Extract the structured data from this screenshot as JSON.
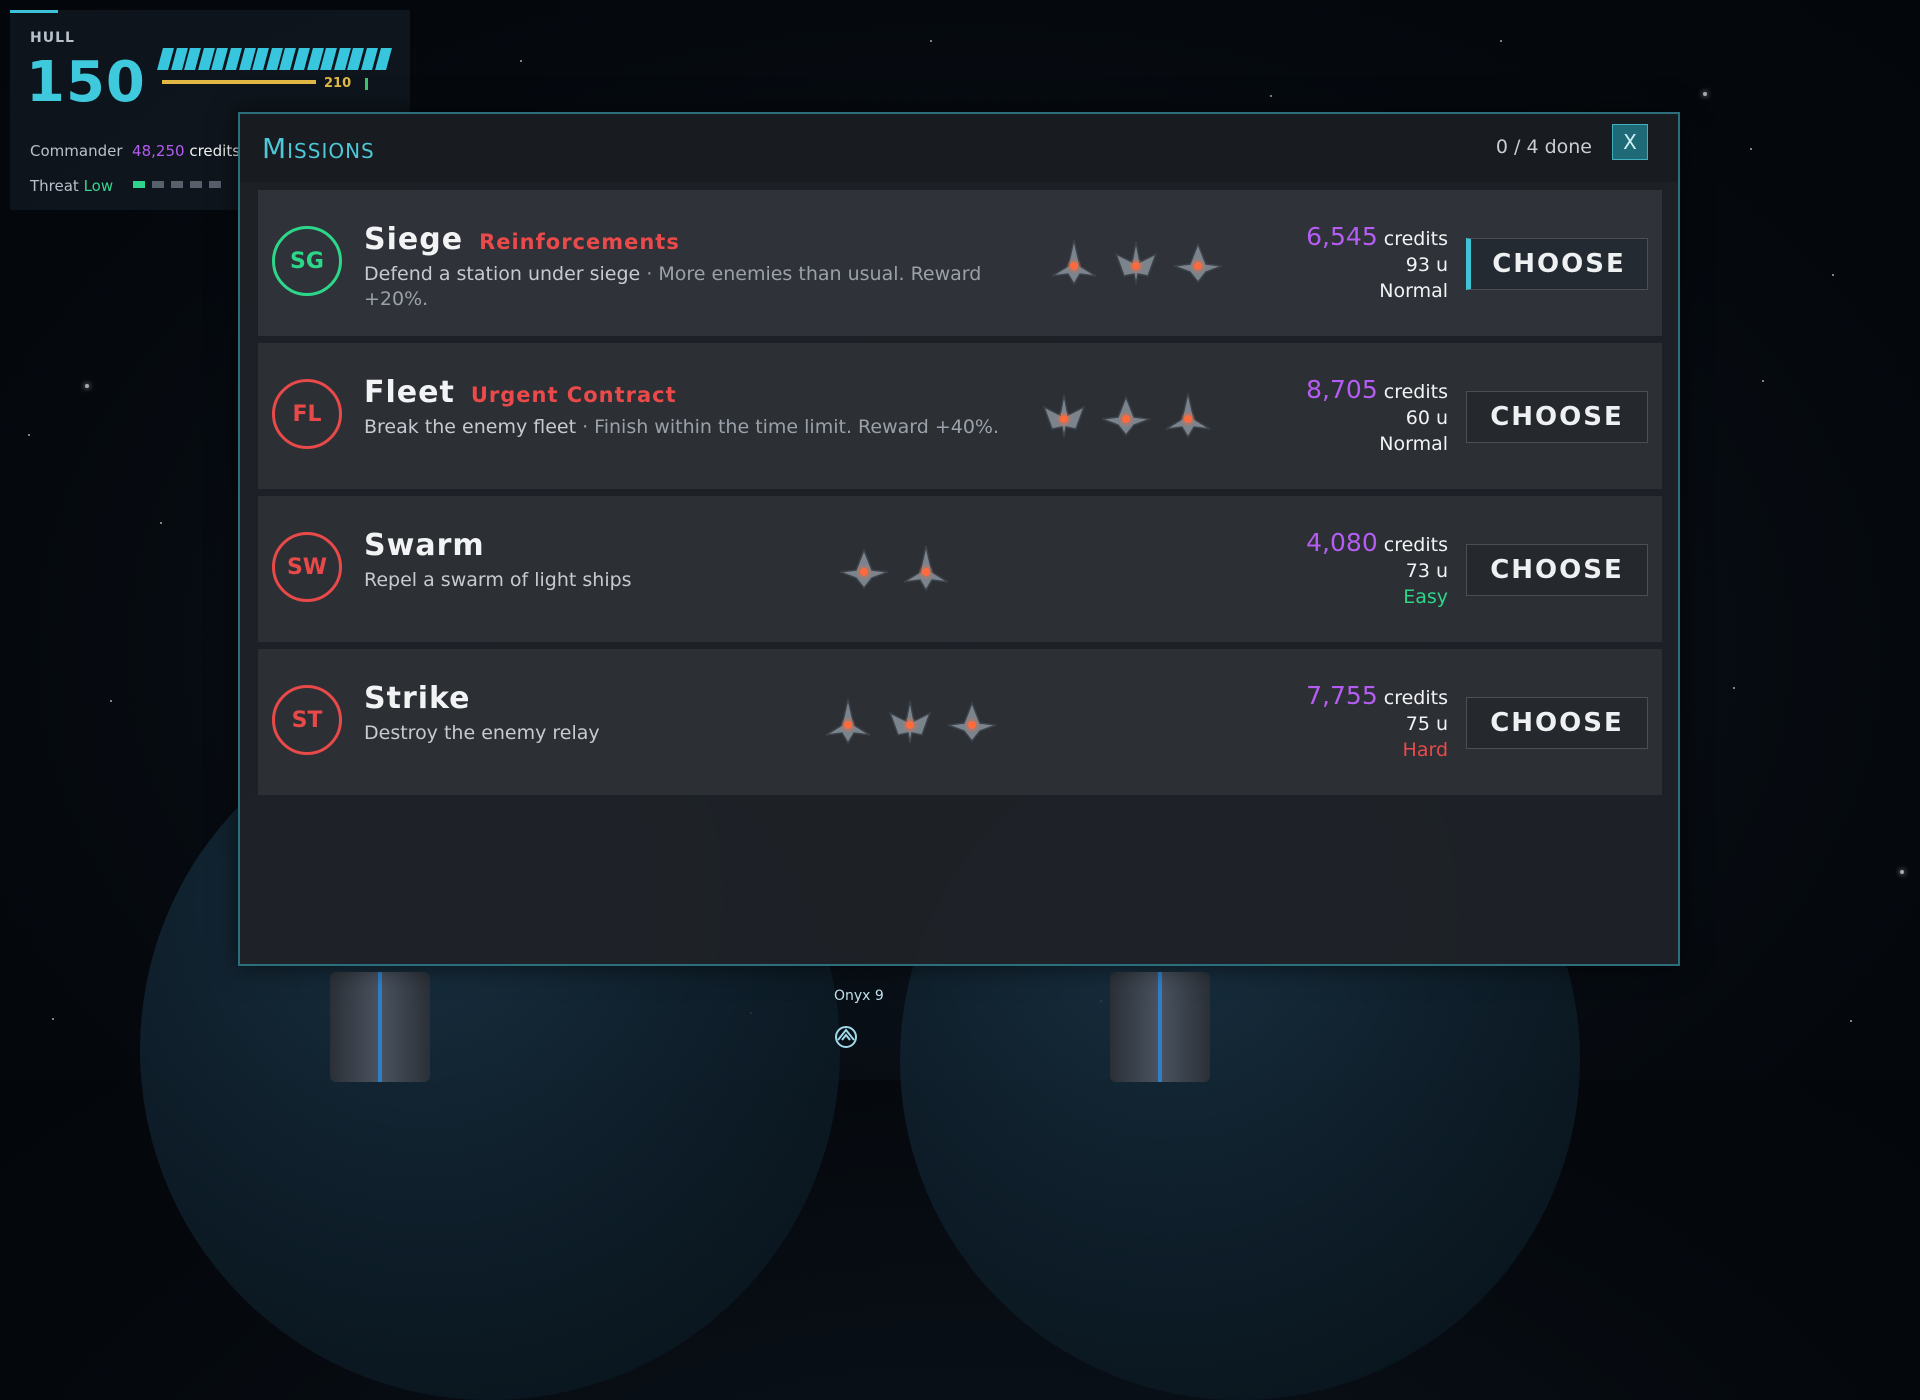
{
  "hud": {
    "hull_label": "HULL",
    "hull_value": "150",
    "hull_max": "210",
    "commander_label": "Commander",
    "credits_value": "48,250",
    "credits_label": "credits",
    "threat_label": "Threat",
    "threat_level": "Low",
    "threat_segments_filled": 1,
    "threat_segments_total": 5
  },
  "dialog": {
    "title": "Missions",
    "progress": "0 / 4 done",
    "close_label": "X"
  },
  "missions": [
    {
      "badge": "SG",
      "badge_color": "#2dd78a",
      "name": "Siege",
      "tag": "Reinforcements",
      "description": "Defend a station under siege",
      "extra": "· More enemies than usual. Reward +20%.",
      "credits": "6,545",
      "credits_label": "credits",
      "units": "93 u",
      "difficulty": "Normal",
      "button": "CHOOSE",
      "ships": 3
    },
    {
      "badge": "FL",
      "badge_color": "#e84949",
      "name": "Fleet",
      "tag": "Urgent Contract",
      "description": "Break the enemy fleet",
      "extra": "· Finish within the time limit. Reward +40%.",
      "credits": "8,705",
      "credits_label": "credits",
      "units": "60 u",
      "difficulty": "Normal",
      "button": "CHOOSE",
      "ships": 3
    },
    {
      "badge": "SW",
      "badge_color": "#e84949",
      "name": "Swarm",
      "tag": "",
      "description": "Repel a swarm of light ships",
      "extra": "",
      "credits": "4,080",
      "credits_label": "credits",
      "units": "73 u",
      "difficulty": "Easy",
      "button": "CHOOSE",
      "ships": 2
    },
    {
      "badge": "ST",
      "badge_color": "#e84949",
      "name": "Strike",
      "tag": "",
      "description": "Destroy the enemy relay",
      "extra": "",
      "credits": "7,755",
      "credits_label": "credits",
      "units": "75 u",
      "difficulty": "Hard",
      "button": "CHOOSE",
      "ships": 3
    }
  ],
  "planet": {
    "name": "Onyx 9"
  },
  "colors": {
    "accent": "#3fc9dd",
    "credits": "#b55cf2",
    "easy": "#2dd78a",
    "hard": "#ea4a4a"
  }
}
